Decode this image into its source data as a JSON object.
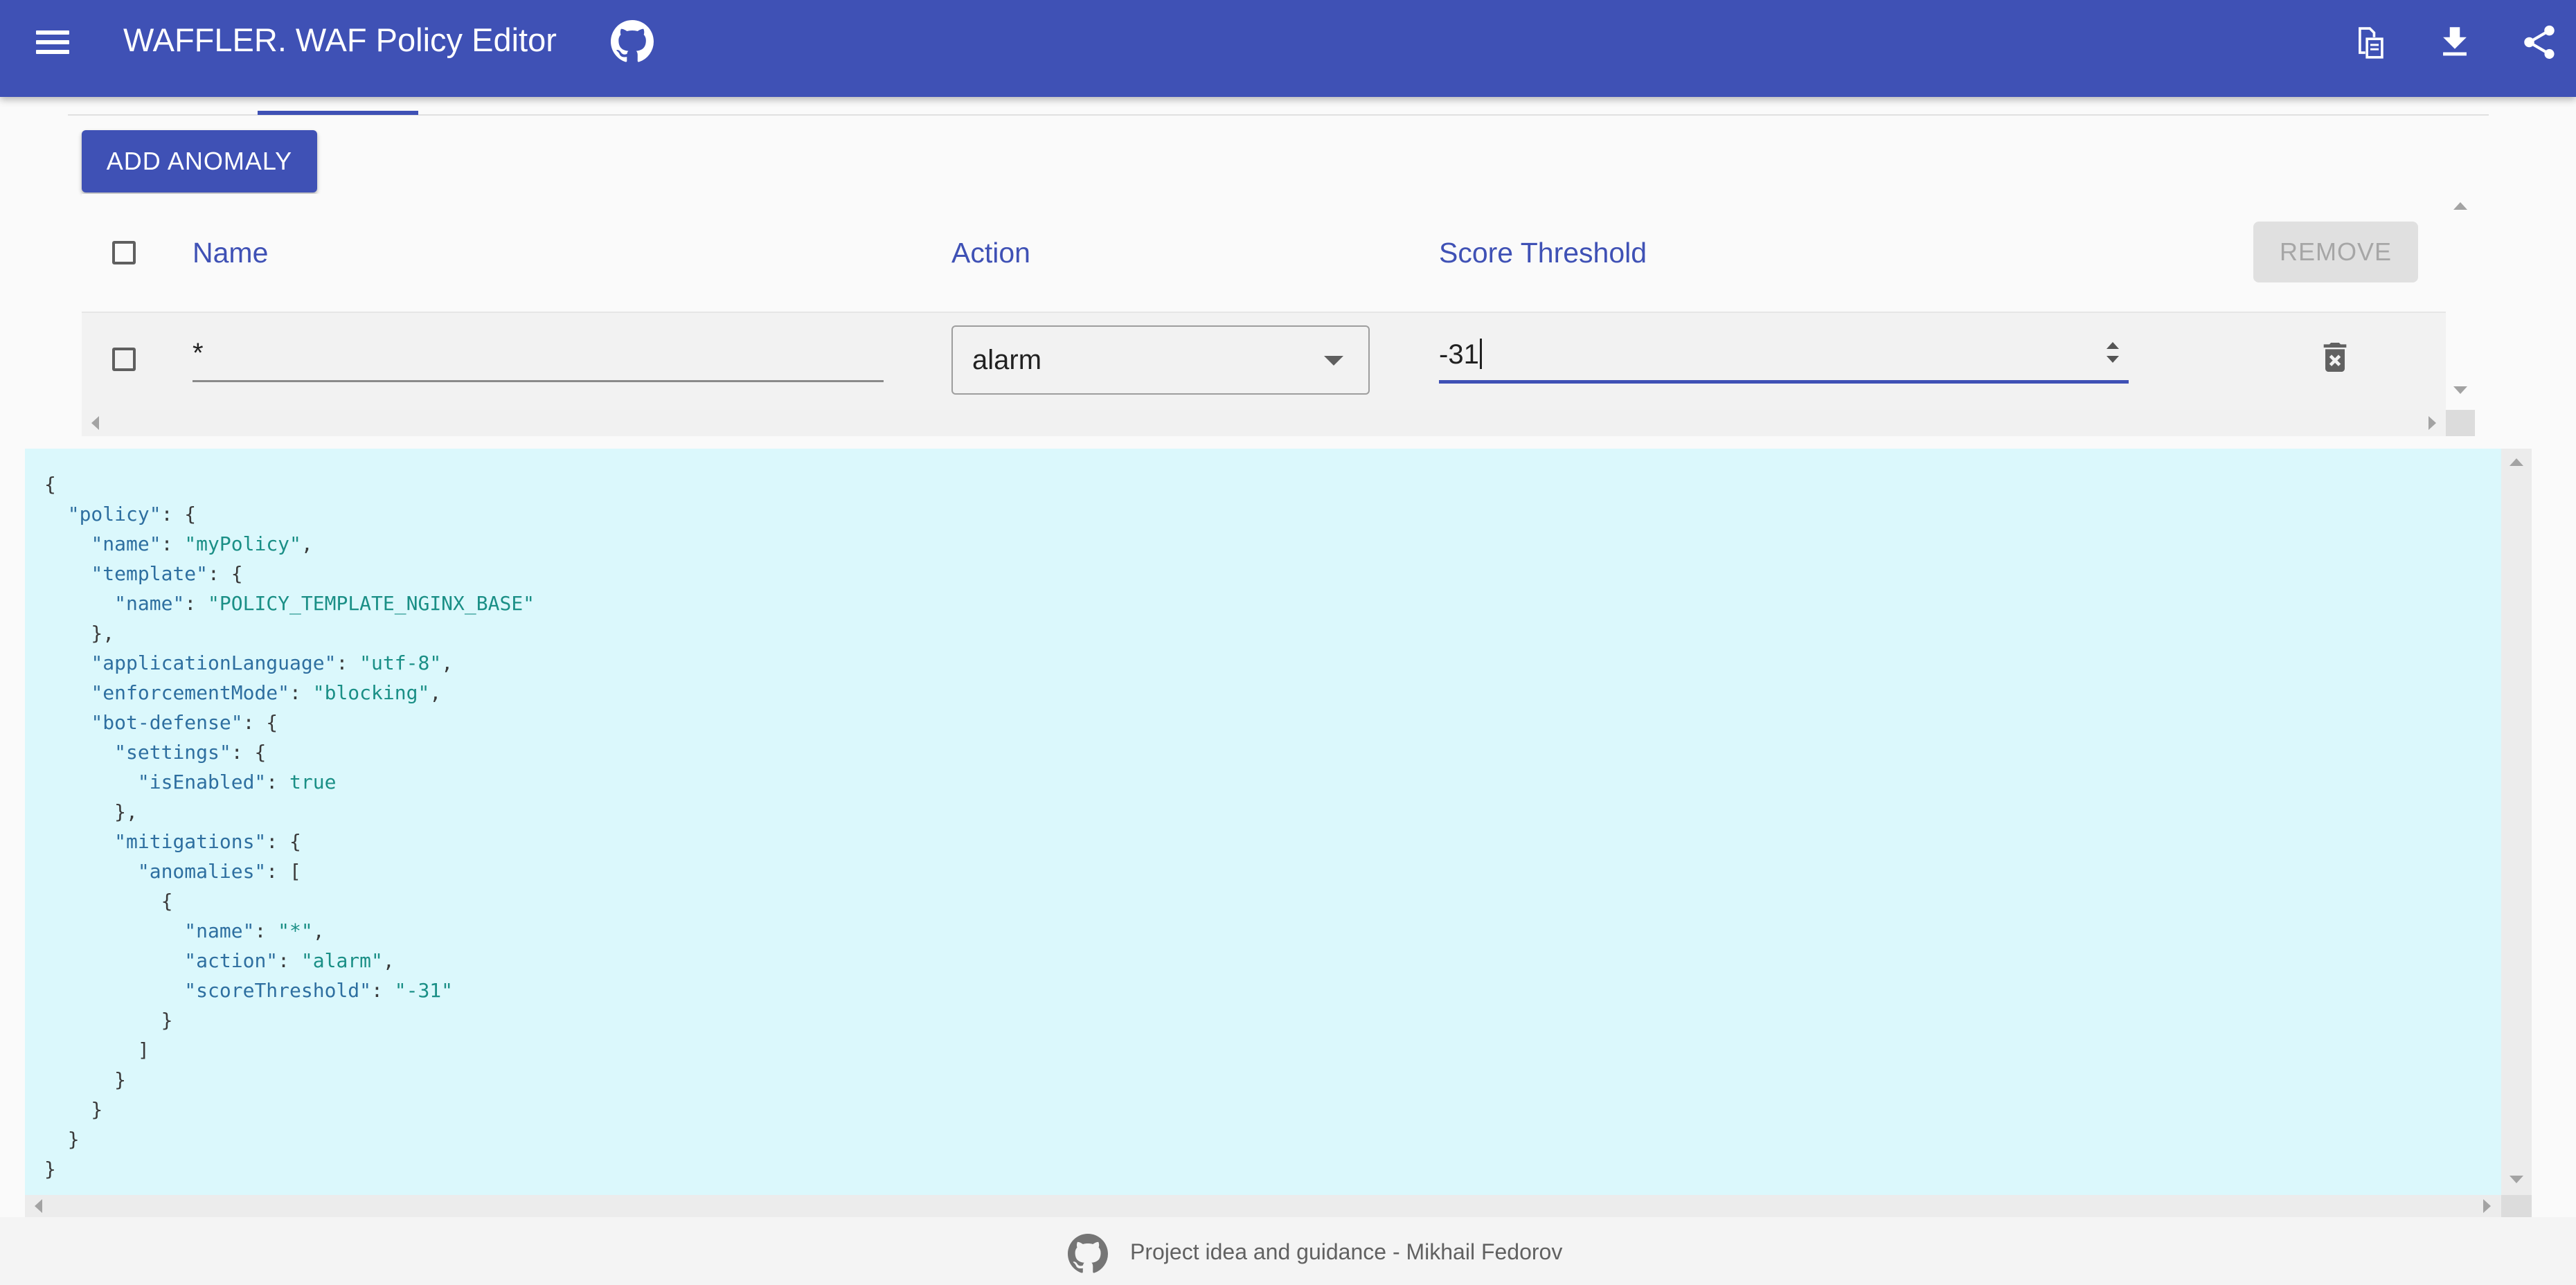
{
  "app": {
    "title": "WAFFLER. WAF Policy Editor"
  },
  "toolbar": {
    "icons": [
      "menu-icon",
      "github-icon",
      "paste-json-icon",
      "download-icon",
      "share-icon"
    ]
  },
  "anomalies": {
    "add_button_label": "ADD ANOMALY",
    "remove_button_label": "REMOVE",
    "columns": {
      "name": "Name",
      "action": "Action",
      "score_threshold": "Score Threshold"
    },
    "rows": [
      {
        "name": "*",
        "action": "alarm",
        "score_threshold": "-31"
      }
    ]
  },
  "json_editor": {
    "content": "{\n  \"policy\": {\n    \"name\": \"myPolicy\",\n    \"template\": {\n      \"name\": \"POLICY_TEMPLATE_NGINX_BASE\"\n    },\n    \"applicationLanguage\": \"utf-8\",\n    \"enforcementMode\": \"blocking\",\n    \"bot-defense\": {\n      \"settings\": {\n        \"isEnabled\": true\n      },\n      \"mitigations\": {\n        \"anomalies\": [\n          {\n            \"name\": \"*\",\n            \"action\": \"alarm\",\n            \"scoreThreshold\": \"-31\"\n          }\n        ]\n      }\n    }\n  }\n}"
  },
  "footer": {
    "text": "Project idea and guidance - Mikhail Fedorov"
  },
  "colors": {
    "primary": "#3f51b5",
    "editor_background": "#dbf8fc",
    "json_key": "#2e6fa0",
    "json_string": "#1a8f86"
  }
}
